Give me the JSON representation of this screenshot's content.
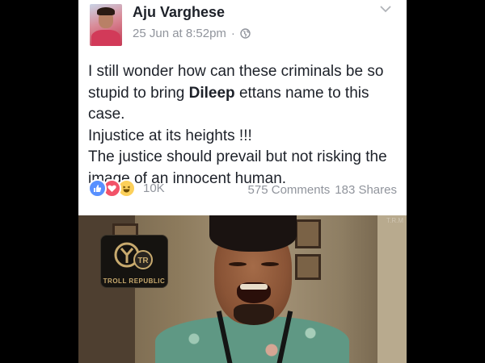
{
  "post": {
    "author": "Aju Varghese",
    "timestamp": "25 Jun at 8:52pm",
    "separator": "·",
    "privacy_icon": "globe-icon",
    "menu_icon": "chevron-down-icon",
    "body": {
      "line1_prefix": "I still wonder how can these criminals be so stupid to bring ",
      "line1_bold": "Dileep",
      "line1_suffix": " ettans name to this case.",
      "line2": "Injustice at its heights !!!",
      "line3": "The justice should prevail but not risking the image of an innocent human."
    },
    "reactions": {
      "icons": [
        "like-icon",
        "love-icon",
        "haha-icon"
      ],
      "count": "10K",
      "comments": "575 Comments",
      "shares": "183 Shares"
    },
    "colors": {
      "name": "#1d2129",
      "meta": "#90949c",
      "like": "#5890ff",
      "love": "#f25268",
      "haha": "#fcd05a"
    }
  },
  "image": {
    "logo_text": "TROLL REPUBLIC",
    "watermark": "T.R.M"
  }
}
